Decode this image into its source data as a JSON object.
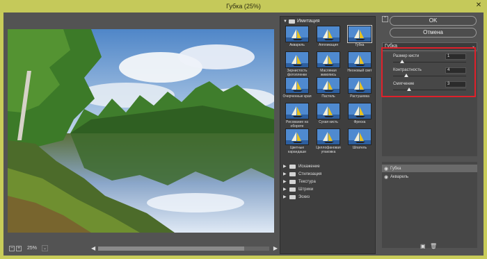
{
  "window": {
    "title": "Губка (25%)",
    "close_glyph": "✕"
  },
  "preview": {
    "zoom": "25%",
    "zoom_minus": "−",
    "zoom_plus": "+",
    "dropdown_glyph": "⌄",
    "left_arrow": "◀",
    "right_arrow": "▶"
  },
  "gallery": {
    "category": "Имитация",
    "category_arrow": "▼",
    "filters": [
      {
        "label": "Акварель",
        "selected": false
      },
      {
        "label": "Аппликация",
        "selected": false
      },
      {
        "label": "Губка",
        "selected": true
      },
      {
        "label": "Зернистость фотопленки",
        "selected": false
      },
      {
        "label": "Масляная живопись",
        "selected": false
      },
      {
        "label": "Неоновый свет",
        "selected": false
      },
      {
        "label": "Очерченные края",
        "selected": false
      },
      {
        "label": "Пастель",
        "selected": false
      },
      {
        "label": "Растушевка",
        "selected": false
      },
      {
        "label": "Рисование на обороте",
        "selected": false
      },
      {
        "label": "Сухая кисть",
        "selected": false
      },
      {
        "label": "Фреска",
        "selected": false
      },
      {
        "label": "Цветные карандаши",
        "selected": false
      },
      {
        "label": "Целлофановая упаковка",
        "selected": false
      },
      {
        "label": "Шпатель",
        "selected": false
      }
    ],
    "subcategories": [
      {
        "label": "Искажение",
        "arrow": "▶"
      },
      {
        "label": "Стилизация",
        "arrow": "▶"
      },
      {
        "label": "Текстура",
        "arrow": "▶"
      },
      {
        "label": "Штрихи",
        "arrow": "▶"
      },
      {
        "label": "Эскиз",
        "arrow": "▶"
      }
    ]
  },
  "panel": {
    "collapse_glyph": "⌃",
    "ok_label": "OK",
    "cancel_label": "Отмена",
    "filter_select": "Губка",
    "select_arrow": "⌄",
    "params": [
      {
        "label": "Размер кисти",
        "value": "1",
        "slider_fraction": 0.1
      },
      {
        "label": "Контрастность",
        "value": "4",
        "slider_fraction": 0.16
      },
      {
        "label": "Смягчение",
        "value": "3",
        "slider_fraction": 0.2
      }
    ]
  },
  "layers": [
    {
      "label": "Губка",
      "active": true,
      "eye": "◉"
    },
    {
      "label": "Акварель",
      "active": false,
      "eye": "◉"
    }
  ],
  "layer_buttons": {
    "new_glyph": "▣",
    "delete_glyph": "🗑"
  },
  "colors": {
    "window_frame": "#c8cc5a",
    "panel": "#535353",
    "highlight_box": "#e0202a"
  }
}
